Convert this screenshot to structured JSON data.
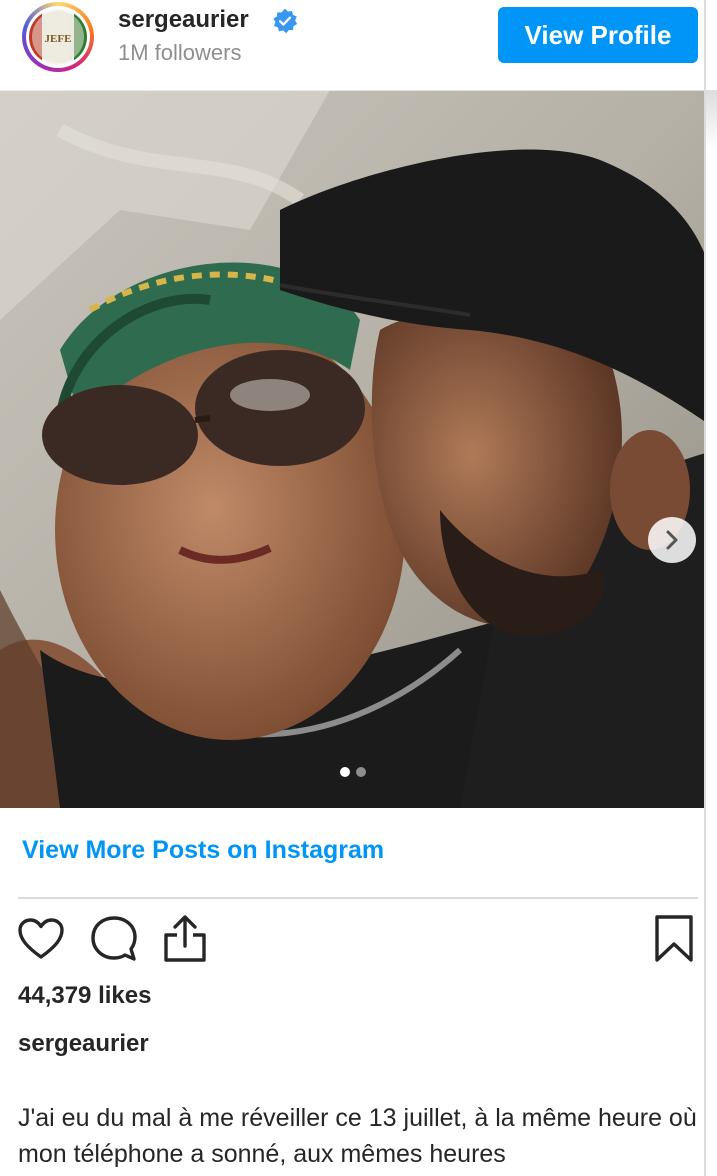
{
  "header": {
    "username": "sergeaurier",
    "verified": true,
    "followers": "1M followers",
    "view_profile_label": "View Profile",
    "avatar_text": "JEFE"
  },
  "post": {
    "carousel": {
      "total": 2,
      "current": 1
    },
    "view_more_label": "View More Posts on Instagram",
    "likes": "44,379 likes",
    "caption_user": "sergeaurier",
    "caption_text": "J'ai eu du mal à me réveiller ce 13 juillet, à la même heure où mon téléphone a sonné, aux mêmes heures"
  },
  "icons": {
    "like": "heart-icon",
    "comment": "comment-icon",
    "share": "share-icon",
    "save": "bookmark-icon",
    "next": "chevron-right-icon",
    "verified": "verified-badge-icon"
  },
  "colors": {
    "accent": "#0095f6",
    "text": "#262626",
    "muted": "#8e8e8e"
  }
}
